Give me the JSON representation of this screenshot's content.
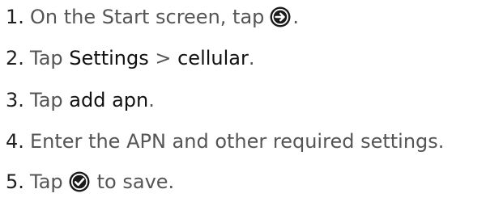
{
  "steps": [
    {
      "number": "1.",
      "text_before": "On the Start screen, tap",
      "icon": "arrow-right-circle-icon",
      "text_after": "."
    },
    {
      "number": "2.",
      "text_before": "Tap",
      "bold_1": "Settings",
      "separator": ">",
      "bold_2": "cellular",
      "text_after": "."
    },
    {
      "number": "3.",
      "text_before": "Tap",
      "bold_1": "add apn",
      "text_after": "."
    },
    {
      "number": "4.",
      "text_before": "Enter the APN and other required settings."
    },
    {
      "number": "5.",
      "text_before": "Tap",
      "icon": "checkmark-circle-icon",
      "text_after": "to save."
    }
  ],
  "colors": {
    "body_text": "#555555",
    "emphasis_text": "#111111",
    "icon_fill": "#1a1a1a",
    "icon_glyph": "#ffffff"
  }
}
